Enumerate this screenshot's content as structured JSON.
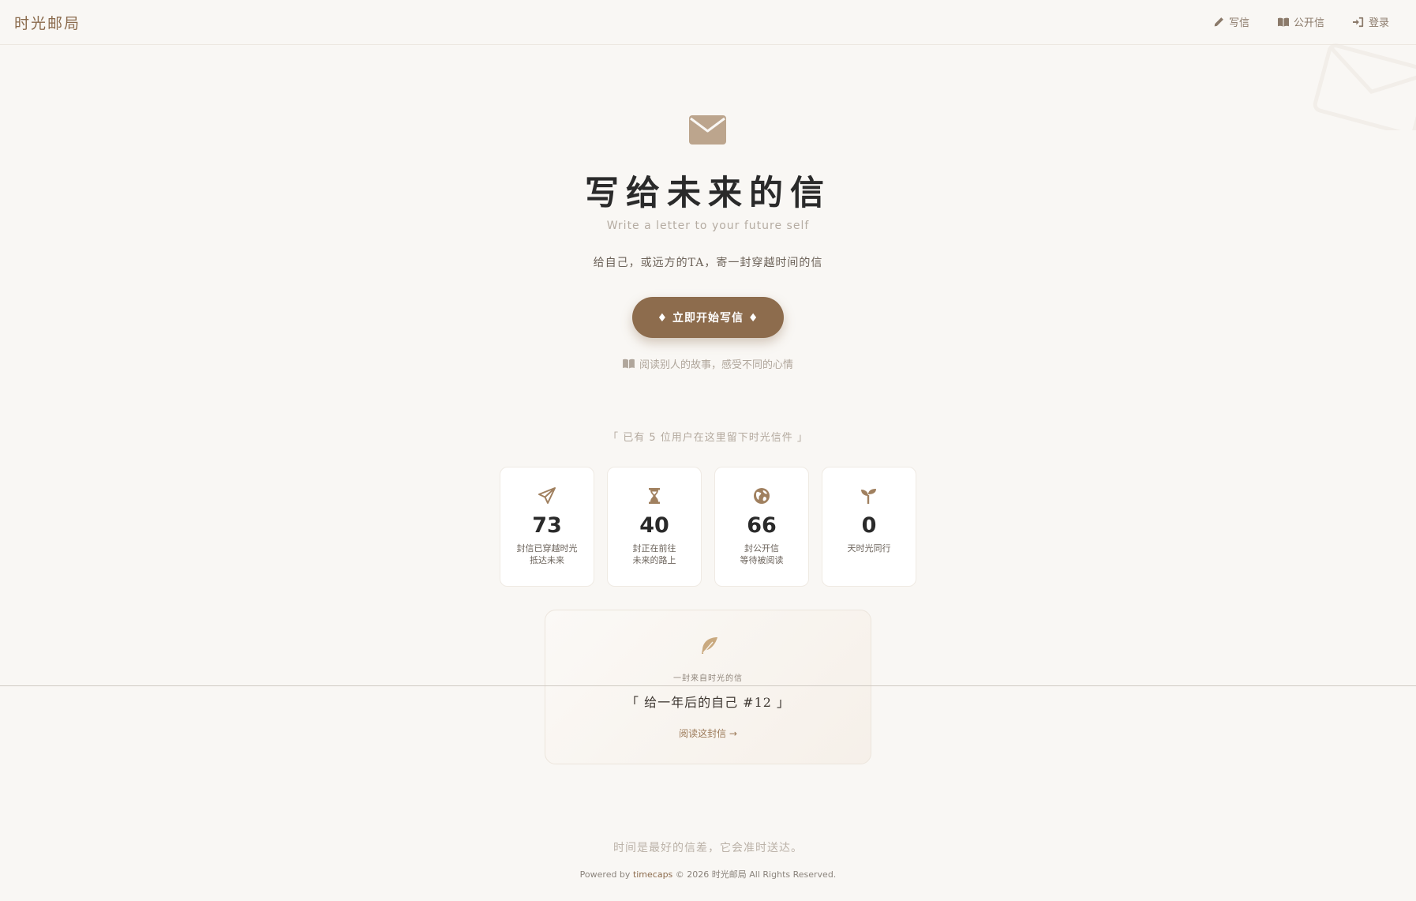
{
  "header": {
    "brand": "时光邮局",
    "nav": [
      {
        "label": "写信",
        "icon": "pencil-icon"
      },
      {
        "label": "公开信",
        "icon": "book-icon"
      },
      {
        "label": "登录",
        "icon": "login-icon"
      }
    ]
  },
  "hero": {
    "icon": "envelope-icon",
    "title": "写给未来的信",
    "subtitle": "Write a letter to your future self",
    "description": "给自己，或远方的TA，寄一封穿越时间的信",
    "cta_label": "♦ 立即开始写信 ♦",
    "read_link": "阅读别人的故事，感受不同的心情",
    "users_line": "「 已有 5 位用户在这里留下时光信件 」"
  },
  "stats": [
    {
      "icon": "paper-plane-icon",
      "value": "73",
      "label": "封信已穿越时光\n抵达未来"
    },
    {
      "icon": "hourglass-icon",
      "value": "40",
      "label": "封正在前往\n未来的路上"
    },
    {
      "icon": "globe-icon",
      "value": "66",
      "label": "封公开信\n等待被阅读"
    },
    {
      "icon": "seedling-icon",
      "value": "0",
      "label": "天时光同行"
    }
  ],
  "featured_letter": {
    "icon": "feather-icon",
    "caption": "一封来自时光的信",
    "title": "「 给一年后的自己 #12 」",
    "link": "阅读这封信 →"
  },
  "footer": {
    "quote": "时间是最好的信差，它会准时送达。",
    "powered_prefix": "Powered by",
    "powered_link": "timecaps",
    "copyright": "© 2026 时光邮局 All Rights Reserved."
  },
  "colors": {
    "background": "#f9f7f4",
    "accent": "#8d6c4d",
    "icon": "#a0805f"
  }
}
